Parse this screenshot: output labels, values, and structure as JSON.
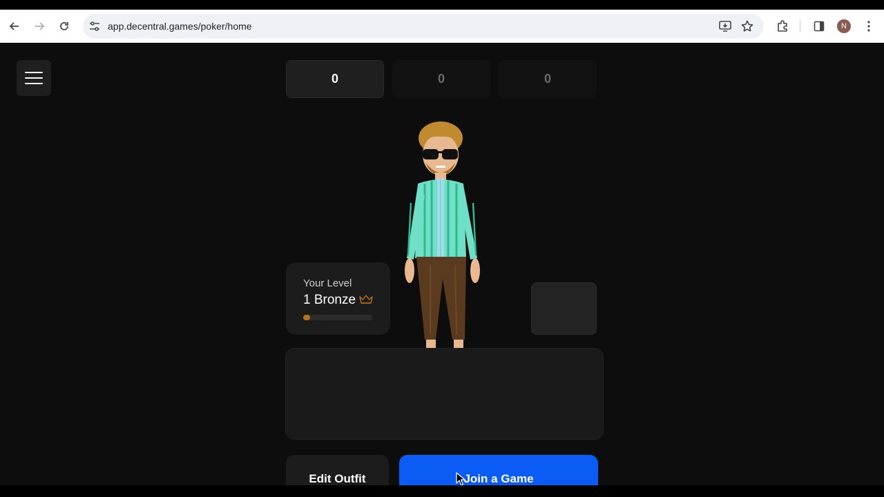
{
  "browser": {
    "url": "app.decentral.games/poker/home",
    "profile_initial": "N"
  },
  "stats": [
    {
      "value": "0"
    },
    {
      "value": "0"
    },
    {
      "value": "0"
    }
  ],
  "level": {
    "label": "Your Level",
    "value": "1 Bronze",
    "progress_fraction": 0.05
  },
  "actions": {
    "edit_outfit": "Edit Outfit",
    "join_game": "Join a Game"
  },
  "colors": {
    "accent_blue": "#0b5bf5",
    "background": "#0d0d0d",
    "bronze": "#b8741a"
  }
}
